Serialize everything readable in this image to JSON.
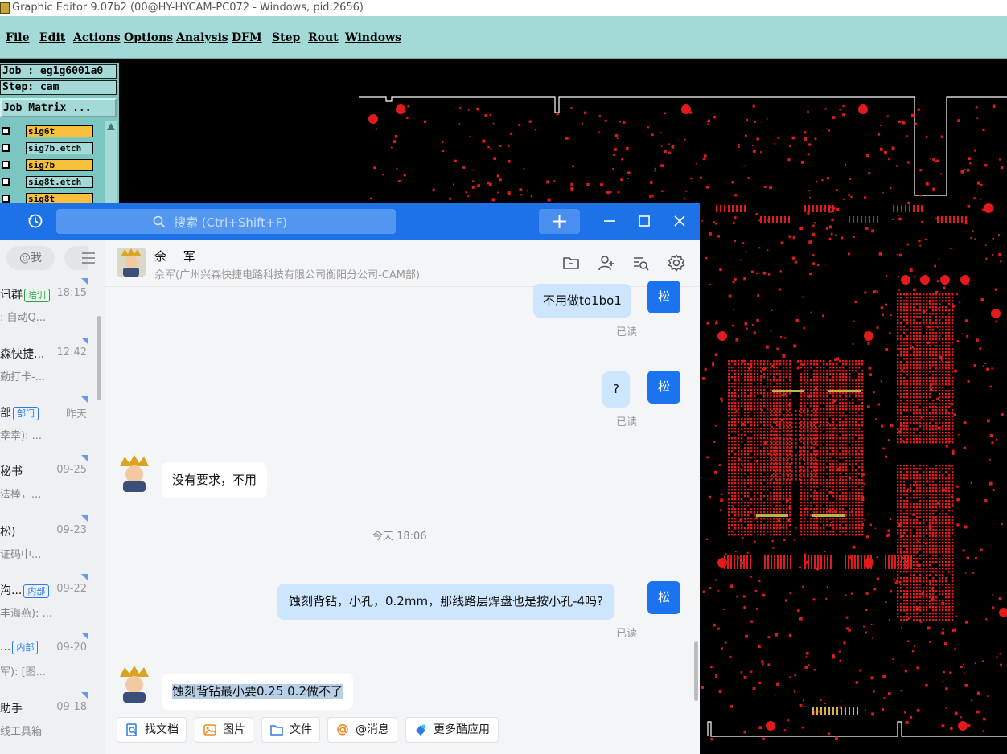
{
  "editor": {
    "title": "Graphic Editor 9.07b2 (00@HY-HYCAM-PC072 - Windows, pid:2656)",
    "menu": [
      "File",
      "Edit",
      "Actions",
      "Options",
      "Analysis",
      "DFM",
      "Step",
      "Rout",
      "Windows"
    ],
    "job_label": "Job : eg1g6001a0",
    "step_label": "Step: cam",
    "job_matrix_button": "Job Matrix ...",
    "layers": [
      {
        "name": "sig6t",
        "color": "#f9c13b"
      },
      {
        "name": "sig7b.etch",
        "color": "#a3d9d6"
      },
      {
        "name": "sig7b",
        "color": "#f9c13b"
      },
      {
        "name": "sig8t.etch",
        "color": "#a3d9d6"
      },
      {
        "name": "sig8t",
        "color": "#f9c13b"
      }
    ],
    "layer_color": "#e11b1b"
  },
  "chat": {
    "search_placeholder": "搜索 (Ctrl+Shift+F)",
    "at_me": "@我",
    "accent": "#1e72e8",
    "conversations": [
      {
        "name": "讯群",
        "tag": "培训",
        "tag_style": "green",
        "time": "18:15",
        "preview": ": 自动Q..."
      },
      {
        "name": "森快捷...",
        "tag": "",
        "tag_style": "",
        "time": "12:42",
        "preview": "勤打卡-..."
      },
      {
        "name": "部",
        "tag": "部门",
        "tag_style": "blue",
        "time": "昨天",
        "preview": "幸幸): ..."
      },
      {
        "name": "秘书",
        "tag": "",
        "tag_style": "",
        "time": "09-25",
        "preview": "法棒，..."
      },
      {
        "name": "松)",
        "tag": "",
        "tag_style": "",
        "time": "09-23",
        "preview": "证码中..."
      },
      {
        "name": "沟...",
        "tag": "内部",
        "tag_style": "blue",
        "time": "09-22",
        "preview": "丰海燕): ..."
      },
      {
        "name": "...",
        "tag": "内部",
        "tag_style": "blue",
        "time": "09-20",
        "preview": "军): [图..."
      },
      {
        "name": "助手",
        "tag": "",
        "tag_style": "",
        "time": "09-18",
        "preview": "线工具箱"
      }
    ],
    "contact": {
      "name": "佘 军",
      "subtitle": "佘军(广州兴森快捷电路科技有限公司衡阳分公司-CAM部)"
    },
    "my_avatar_label": "松",
    "messages": [
      {
        "from": "me",
        "text": "不用做to1bo1",
        "status": "已读"
      },
      {
        "from": "me",
        "text": "?",
        "status": "已读"
      },
      {
        "from": "peer",
        "text": "没有要求，不用"
      },
      {
        "from": "me",
        "text": "蚀刻背钻，小孔，0.2mm，那线路层焊盘也是按小孔-4吗?",
        "status": "已读"
      },
      {
        "from": "peer",
        "text": "蚀刻背钻最小要0.25  0.2做不了"
      }
    ],
    "time_separator": "今天 18:06",
    "quick_actions": [
      "找文档",
      "图片",
      "文件",
      "@消息",
      "更多酷应用"
    ]
  }
}
